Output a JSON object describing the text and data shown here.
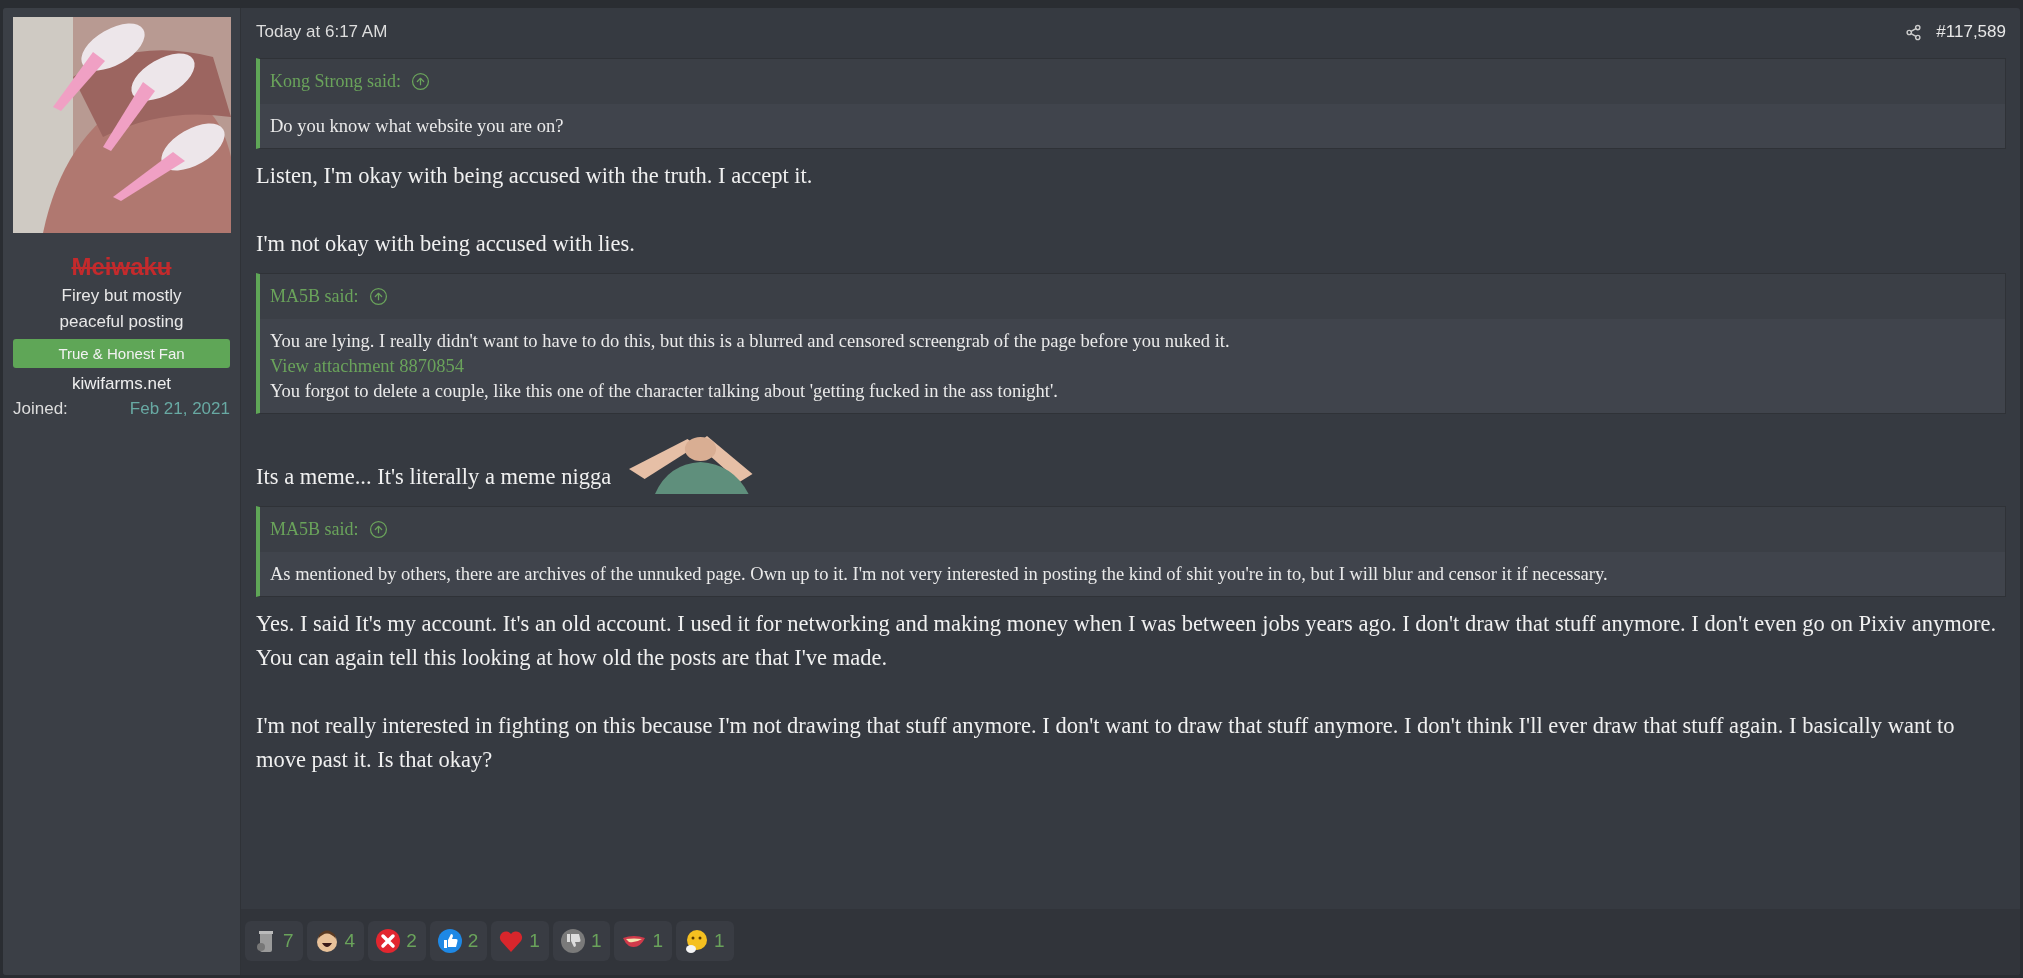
{
  "user": {
    "name": "Meiwaku",
    "banned": true,
    "title": "Firey but mostly peaceful posting",
    "banner": "True & Honest Fan",
    "site": "kiwifarms.net",
    "joined_label": "Joined:",
    "joined_value": "Feb 21, 2021"
  },
  "post": {
    "time": "Today at 6:17 AM",
    "number": "#117,589",
    "blocks": [
      {
        "kind": "quote",
        "author": "Kong Strong said:",
        "lines": [
          {
            "kind": "text",
            "text": "Do you know what website you are on?"
          }
        ]
      },
      {
        "kind": "text",
        "text": "Listen, I'm okay with being accused with the truth. I accept it."
      },
      {
        "kind": "text",
        "text": "I'm not okay with being accused with lies."
      },
      {
        "kind": "quote",
        "author": "MA5B said:",
        "lines": [
          {
            "kind": "text",
            "text": "You are lying. I really didn't want to have to do this, but this is a blurred and censored screengrab of the page before you nuked it."
          },
          {
            "kind": "link",
            "text": "View attachment 8870854"
          },
          {
            "kind": "text",
            "text": "You forgot to delete a couple, like this one of the character talking about 'getting fucked in the ass tonight'."
          }
        ]
      },
      {
        "kind": "text",
        "text": "Its a meme... It's literally a meme nigga"
      },
      {
        "kind": "quote",
        "author": "MA5B said:",
        "lines": [
          {
            "kind": "text",
            "text": "As mentioned by others, there are archives of the unnuked page. Own up to it. I'm not very interested in posting the kind of shit you're in to, but I will blur and censor it if necessary."
          }
        ]
      },
      {
        "kind": "text",
        "text": "Yes. I said It's my account. It's an old account. I used it for networking and making money when I was between jobs years ago. I don't draw that stuff anymore. I don't even go on Pixiv anymore. You can again tell this looking at how old the posts are that I've made."
      },
      {
        "kind": "text",
        "text": "I'm not really interested in fighting on this because I'm not drawing that stuff anymore. I don't want to draw that stuff anymore. I don't think I'll ever draw that stuff again. I basically want to move past it. Is that okay?"
      }
    ],
    "reactions": [
      {
        "kind": "trash",
        "count": "7"
      },
      {
        "kind": "laugh",
        "count": "4"
      },
      {
        "kind": "cross",
        "count": "2"
      },
      {
        "kind": "thumbsup",
        "count": "2"
      },
      {
        "kind": "heart",
        "count": "1"
      },
      {
        "kind": "thumbsdown",
        "count": "1"
      },
      {
        "kind": "lips",
        "count": "1"
      },
      {
        "kind": "thinking",
        "count": "1"
      }
    ]
  }
}
